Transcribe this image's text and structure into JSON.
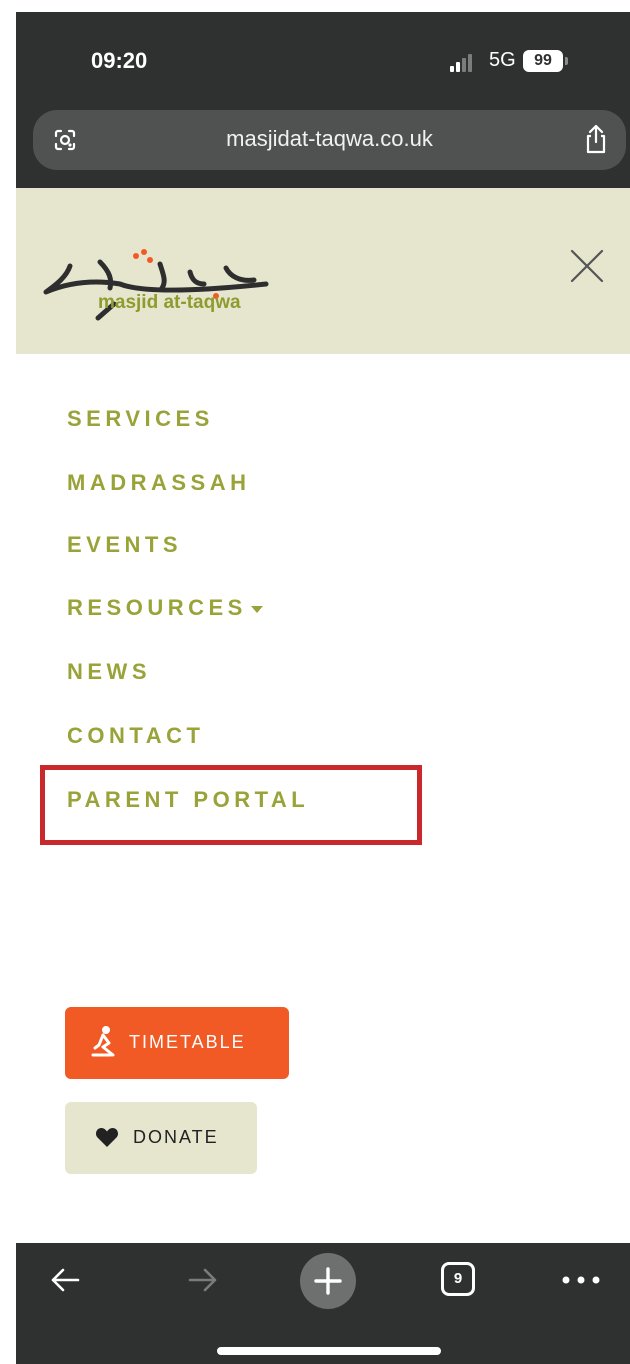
{
  "status_bar": {
    "time": "09:20",
    "network": "5G",
    "battery": "99"
  },
  "browser": {
    "url": "masjidat-taqwa.co.uk",
    "tab_count": "9"
  },
  "site": {
    "logo_text": "masjid at-taqwa",
    "nav_items": [
      "SERVICES",
      "MADRASSAH",
      "EVENTS",
      "RESOURCES",
      "NEWS",
      "CONTACT",
      "PARENT PORTAL"
    ],
    "buttons": {
      "timetable": "TIMETABLE",
      "donate": "DONATE"
    }
  },
  "colors": {
    "accent_green": "#9aa339",
    "header_bg": "#e6e6cf",
    "timetable_orange": "#f15a24",
    "highlight_red": "#c9282d",
    "chrome_dark": "#2f3130"
  }
}
